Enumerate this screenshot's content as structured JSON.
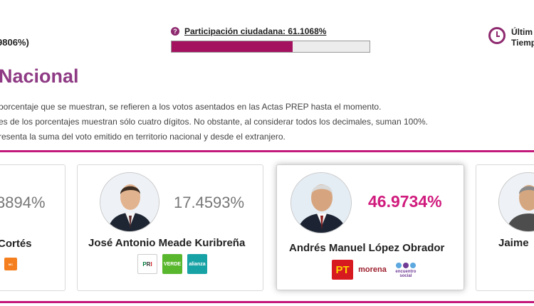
{
  "header": {
    "partial_left_percent": "9806%)",
    "participation_label": "Participación ciudadana: 61.1068%",
    "participation_value": 61.1068,
    "update_line1": "Últim",
    "update_line2": "Tiemp"
  },
  "section": {
    "title": "Nacional",
    "notes": [
      "porcentaje que se muestran, se refieren a los votos asentados en las Actas PREP hasta el momento.",
      "es de los porcentajes muestran sólo cuatro dígitos. No obstante, al considerar todos los decimales, suman 100%.",
      "resenta la suma del voto emitido en territorio nacional y desde el extranjero."
    ]
  },
  "candidates": [
    {
      "name": "Cortés",
      "percent": "3894%",
      "parties": [
        "MOVIMIENTO CIUDADANO"
      ]
    },
    {
      "name": "José Antonio Meade Kuribreña",
      "percent": "17.4593%",
      "parties": [
        "PRI",
        "VERDE",
        "alianza"
      ]
    },
    {
      "name": "Andrés Manuel López Obrador",
      "percent": "46.9734%",
      "parties": [
        "PT",
        "morena",
        "encuentro social"
      ]
    },
    {
      "name": "Jaime",
      "percent": "",
      "parties": []
    }
  ],
  "colors": {
    "accent": "#c2197a",
    "participation_bar": "#a3115f",
    "title": "#8e3a84",
    "leader_percent": "#d01b7d",
    "pri": "#007a3d",
    "verde": "#59b72e",
    "alianza": "#17a2a5",
    "pt": "#d71920",
    "morena": "#9d1f2d",
    "encuentro": "#6f3b95"
  },
  "icons": {
    "help": "question-circle-icon",
    "update": "clock-icon"
  }
}
